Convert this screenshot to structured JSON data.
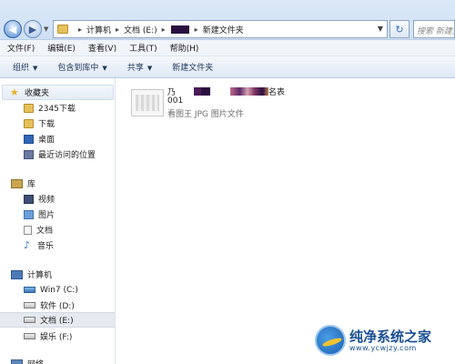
{
  "address_bar": {
    "breadcrumbs": [
      "计算机",
      "文档 (E:)",
      "新建文件夹"
    ],
    "search_placeholder": "搜索 新建文件夹"
  },
  "menu": [
    "文件(F)",
    "编辑(E)",
    "查看(V)",
    "工具(T)",
    "帮助(H)"
  ],
  "toolbar": [
    {
      "label": "组织",
      "dropdown": true
    },
    {
      "label": "包含到库中",
      "dropdown": true
    },
    {
      "label": "共享",
      "dropdown": true
    },
    {
      "label": "新建文件夹",
      "dropdown": false
    }
  ],
  "nav": {
    "favorites": {
      "label": "收藏夹",
      "items": [
        "2345下载",
        "下载",
        "桌面",
        "最近访问的位置"
      ]
    },
    "libraries": {
      "label": "库",
      "items": [
        "视频",
        "图片",
        "文档",
        "音乐"
      ]
    },
    "computer": {
      "label": "计算机",
      "drives": [
        "Win7 (C:)",
        "软件 (D:)",
        "文档 (E:)",
        "娱乐 (F:)"
      ]
    },
    "network": {
      "label": "网络"
    }
  },
  "file": {
    "name_prefix": "乃",
    "name_suffix": "名表",
    "name_line2": "001",
    "type": "看图王 JPG 图片文件"
  },
  "watermark": {
    "text": "纯净系统之家",
    "url": "www.ycwjzy.com"
  },
  "colors": {
    "redaction_purple": "#2a1040",
    "toolbar_text": "#1e395b",
    "watermark_blue": "#1a4f93"
  }
}
